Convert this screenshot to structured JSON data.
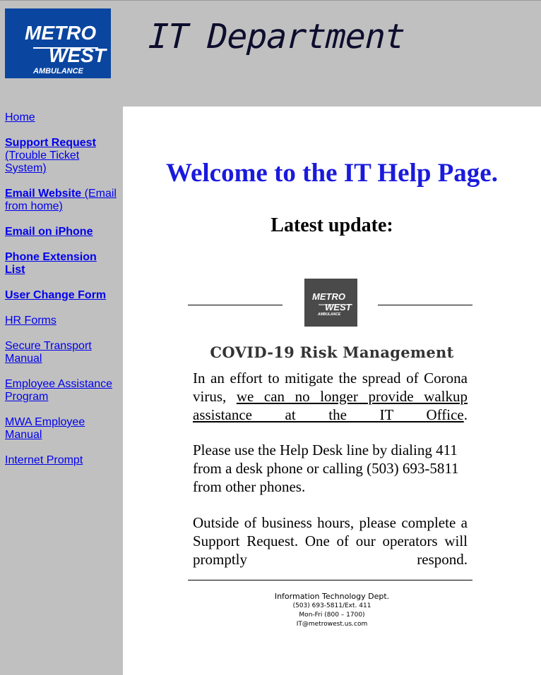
{
  "header": {
    "logo": {
      "line1": "METRO",
      "line2": "WEST",
      "line3": "AMBULANCE"
    },
    "title": "IT Department"
  },
  "sidebar": {
    "items": [
      {
        "bold": "",
        "text": "Home"
      },
      {
        "bold": "Support Request",
        "text": " (Trouble Ticket System)"
      },
      {
        "bold": "Email Website",
        "text": " (Email from home)"
      },
      {
        "bold": "Email on iPhone",
        "text": ""
      },
      {
        "bold": "Phone Extension List",
        "text": ""
      },
      {
        "bold": "User Change Form",
        "text": ""
      },
      {
        "bold": "",
        "text": "HR Forms"
      },
      {
        "bold": "",
        "text": "Secure Transport Manual"
      },
      {
        "bold": "",
        "text": "Employee Assistance Program"
      },
      {
        "bold": "",
        "text": "MWA Employee Manual"
      },
      {
        "bold": "",
        "text": "Internet Prompt"
      }
    ]
  },
  "main": {
    "welcome": "Welcome to the IT Help Page.",
    "latest": "Latest update:",
    "update_logo": {
      "line1": "METRO",
      "line2": "WEST",
      "line3": "AMBULANCE"
    },
    "covid_title": "COVID-19 Risk Management",
    "para1_pre": "In an effort to mitigate the spread of Corona virus, ",
    "para1_link": "we can no longer provide walkup assistance at the IT Office",
    "para1_post": ".",
    "para2": "Please use the Help Desk line by dialing 411 from a desk phone or calling (503) 693-5811 from other phones.",
    "para3": "Outside of business hours, please complete a Support Request. One of our operators will promptly respond."
  },
  "footer": {
    "dept": "Information Technology Dept.",
    "phone": "(503) 693-5811/Ext. 411",
    "hours": "Mon-Fri (800 – 1700)",
    "email": "IT@metrowest.us.com"
  },
  "colors": {
    "sidebar_bg": "#c0c0c0",
    "logo_blue": "#0a46a0",
    "link": "#0000ee",
    "welcome": "#1a1add"
  }
}
